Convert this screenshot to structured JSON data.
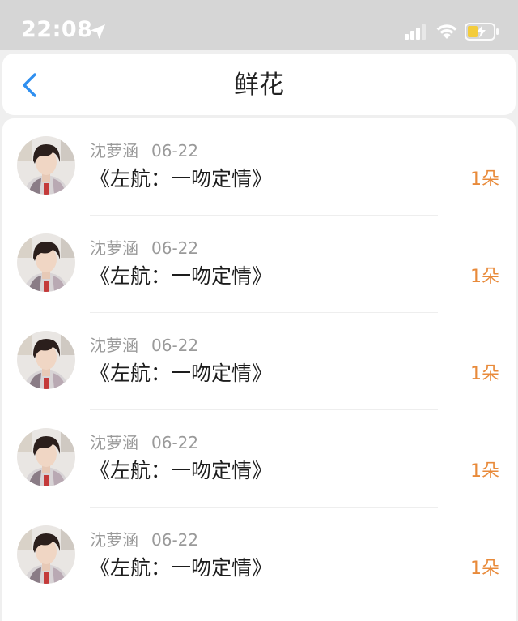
{
  "status_bar": {
    "time": "22:08",
    "icons": [
      "location-arrow-icon",
      "cellular-signal-icon",
      "wifi-icon",
      "battery-charging-icon"
    ]
  },
  "header": {
    "title": "鲜花",
    "back_icon": "chevron-left-icon"
  },
  "colors": {
    "accent": "#2f8ff0",
    "count": "#e88a3a",
    "status_bar_bg": "#d6d6d6",
    "page_bg": "#efefef"
  },
  "items": [
    {
      "name": "沈萝涵",
      "date": "06-22",
      "title": "《左航：一吻定情》",
      "count": "1朵"
    },
    {
      "name": "沈萝涵",
      "date": "06-22",
      "title": "《左航：一吻定情》",
      "count": "1朵"
    },
    {
      "name": "沈萝涵",
      "date": "06-22",
      "title": "《左航：一吻定情》",
      "count": "1朵"
    },
    {
      "name": "沈萝涵",
      "date": "06-22",
      "title": "《左航：一吻定情》",
      "count": "1朵"
    },
    {
      "name": "沈萝涵",
      "date": "06-22",
      "title": "《左航：一吻定情》",
      "count": "1朵"
    }
  ]
}
